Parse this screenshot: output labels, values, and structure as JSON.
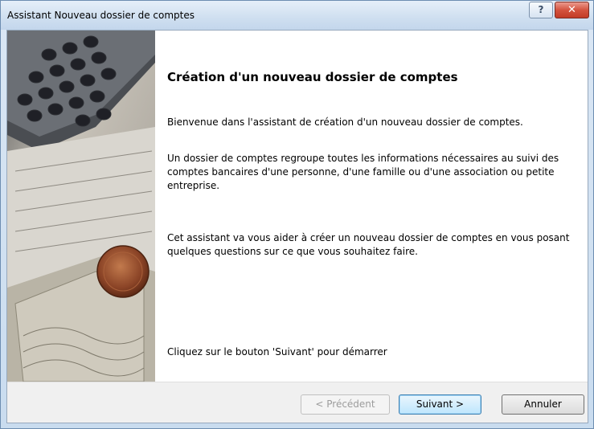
{
  "window": {
    "title": "Assistant Nouveau dossier de comptes",
    "help_label": "?",
    "close_label": "✕"
  },
  "side_image": {
    "icon": "finance-photo-calculator-banknotes-coin"
  },
  "content": {
    "heading": "Création d'un nouveau dossier de comptes",
    "welcome": "Bienvenue dans l'assistant de création d'un nouveau dossier de comptes.",
    "description": "Un dossier de comptes regroupe toutes les informations nécessaires au suivi des comptes bancaires d'une personne, d'une famille ou d'une association ou petite entreprise.",
    "purpose": "Cet assistant va vous aider à créer un nouveau dossier de comptes en vous posant quelques questions sur ce que vous souhaitez faire.",
    "instruction": "Cliquez sur le bouton 'Suivant' pour démarrer"
  },
  "buttons": {
    "previous": "< Précédent",
    "next": "Suivant >",
    "cancel": "Annuler"
  }
}
